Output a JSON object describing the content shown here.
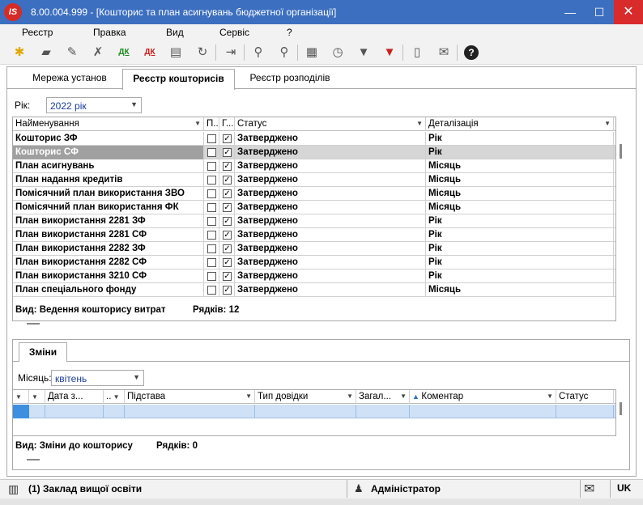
{
  "window": {
    "logo": "IS",
    "title": "8.00.004.999 - [Кошторис та план асигнувань бюджетної організації]",
    "btn_min": "—",
    "btn_max": "☐",
    "btn_close": "✕"
  },
  "menu": [
    "Реєстр",
    "Правка",
    "Вид",
    "Сервіс",
    "?"
  ],
  "toolbar_icons": [
    "new-icon",
    "open-folder-icon",
    "edit-icon",
    "delete-icon",
    "dk-green-icon",
    "dk-red-icon",
    "print-icon",
    "refresh-icon",
    "exit-icon",
    "search-icon",
    "search-next-icon",
    "table-icon",
    "clock-doc-icon",
    "filter-icon",
    "filter-clear-icon",
    "document-icon",
    "mail-icon",
    "help-icon"
  ],
  "tabs": [
    "Мережа установ",
    "Реєстр кошторисів",
    "Реєстр розподілів"
  ],
  "year": {
    "label": "Рік:",
    "value": "2022 рік"
  },
  "grid1": {
    "headers": {
      "name": "Найменування",
      "p": "П...",
      "g": "Г...",
      "status": "Статус",
      "detail": "Деталізація"
    },
    "rows": [
      {
        "name": "Кошторис ЗФ",
        "p": false,
        "g": true,
        "status": "Затверджено",
        "detail": "Рік"
      },
      {
        "name": "Кошторис СФ",
        "p": false,
        "g": true,
        "status": "Затверджено",
        "detail": "Рік"
      },
      {
        "name": "План асигнувань",
        "p": false,
        "g": true,
        "status": "Затверджено",
        "detail": "Місяць"
      },
      {
        "name": "План надання кредитів",
        "p": false,
        "g": true,
        "status": "Затверджено",
        "detail": "Місяць"
      },
      {
        "name": "Помісячний план використання ЗВО",
        "p": false,
        "g": true,
        "status": "Затверджено",
        "detail": "Місяць"
      },
      {
        "name": "Помісячний план використання ФК",
        "p": false,
        "g": true,
        "status": "Затверджено",
        "detail": "Місяць"
      },
      {
        "name": "План використання 2281 ЗФ",
        "p": false,
        "g": true,
        "status": "Затверджено",
        "detail": "Рік"
      },
      {
        "name": "План використання 2281 СФ",
        "p": false,
        "g": true,
        "status": "Затверджено",
        "detail": "Рік"
      },
      {
        "name": "План використання 2282 ЗФ",
        "p": false,
        "g": true,
        "status": "Затверджено",
        "detail": "Рік"
      },
      {
        "name": "План використання 2282 СФ",
        "p": false,
        "g": true,
        "status": "Затверджено",
        "detail": "Рік"
      },
      {
        "name": "План використання 3210 СФ",
        "p": false,
        "g": true,
        "status": "Затверджено",
        "detail": "Рік"
      },
      {
        "name": "План спеціального фонду",
        "p": false,
        "g": true,
        "status": "Затверджено",
        "detail": "Місяць"
      }
    ],
    "selected_row": 1,
    "view_label": "Вид: Ведення кошторису витрат",
    "rows_label": "Рядків: 12"
  },
  "changes": {
    "tab_label": "Зміни",
    "month_label": "Місяць:",
    "month_value": "квітень",
    "headers": {
      "date": "Дата з...",
      "dots": "..",
      "basis": "Підстава",
      "ref_type": "Тип довідки",
      "total": "Загал...",
      "comment": "Коментар",
      "status": "Статус"
    },
    "view_label": "Вид: Зміни до кошторису",
    "rows_label": "Рядків: 0"
  },
  "statusbar": {
    "org": "(1) Заклад вищої освіти",
    "user": "Адміністратор",
    "lang": "UK"
  }
}
